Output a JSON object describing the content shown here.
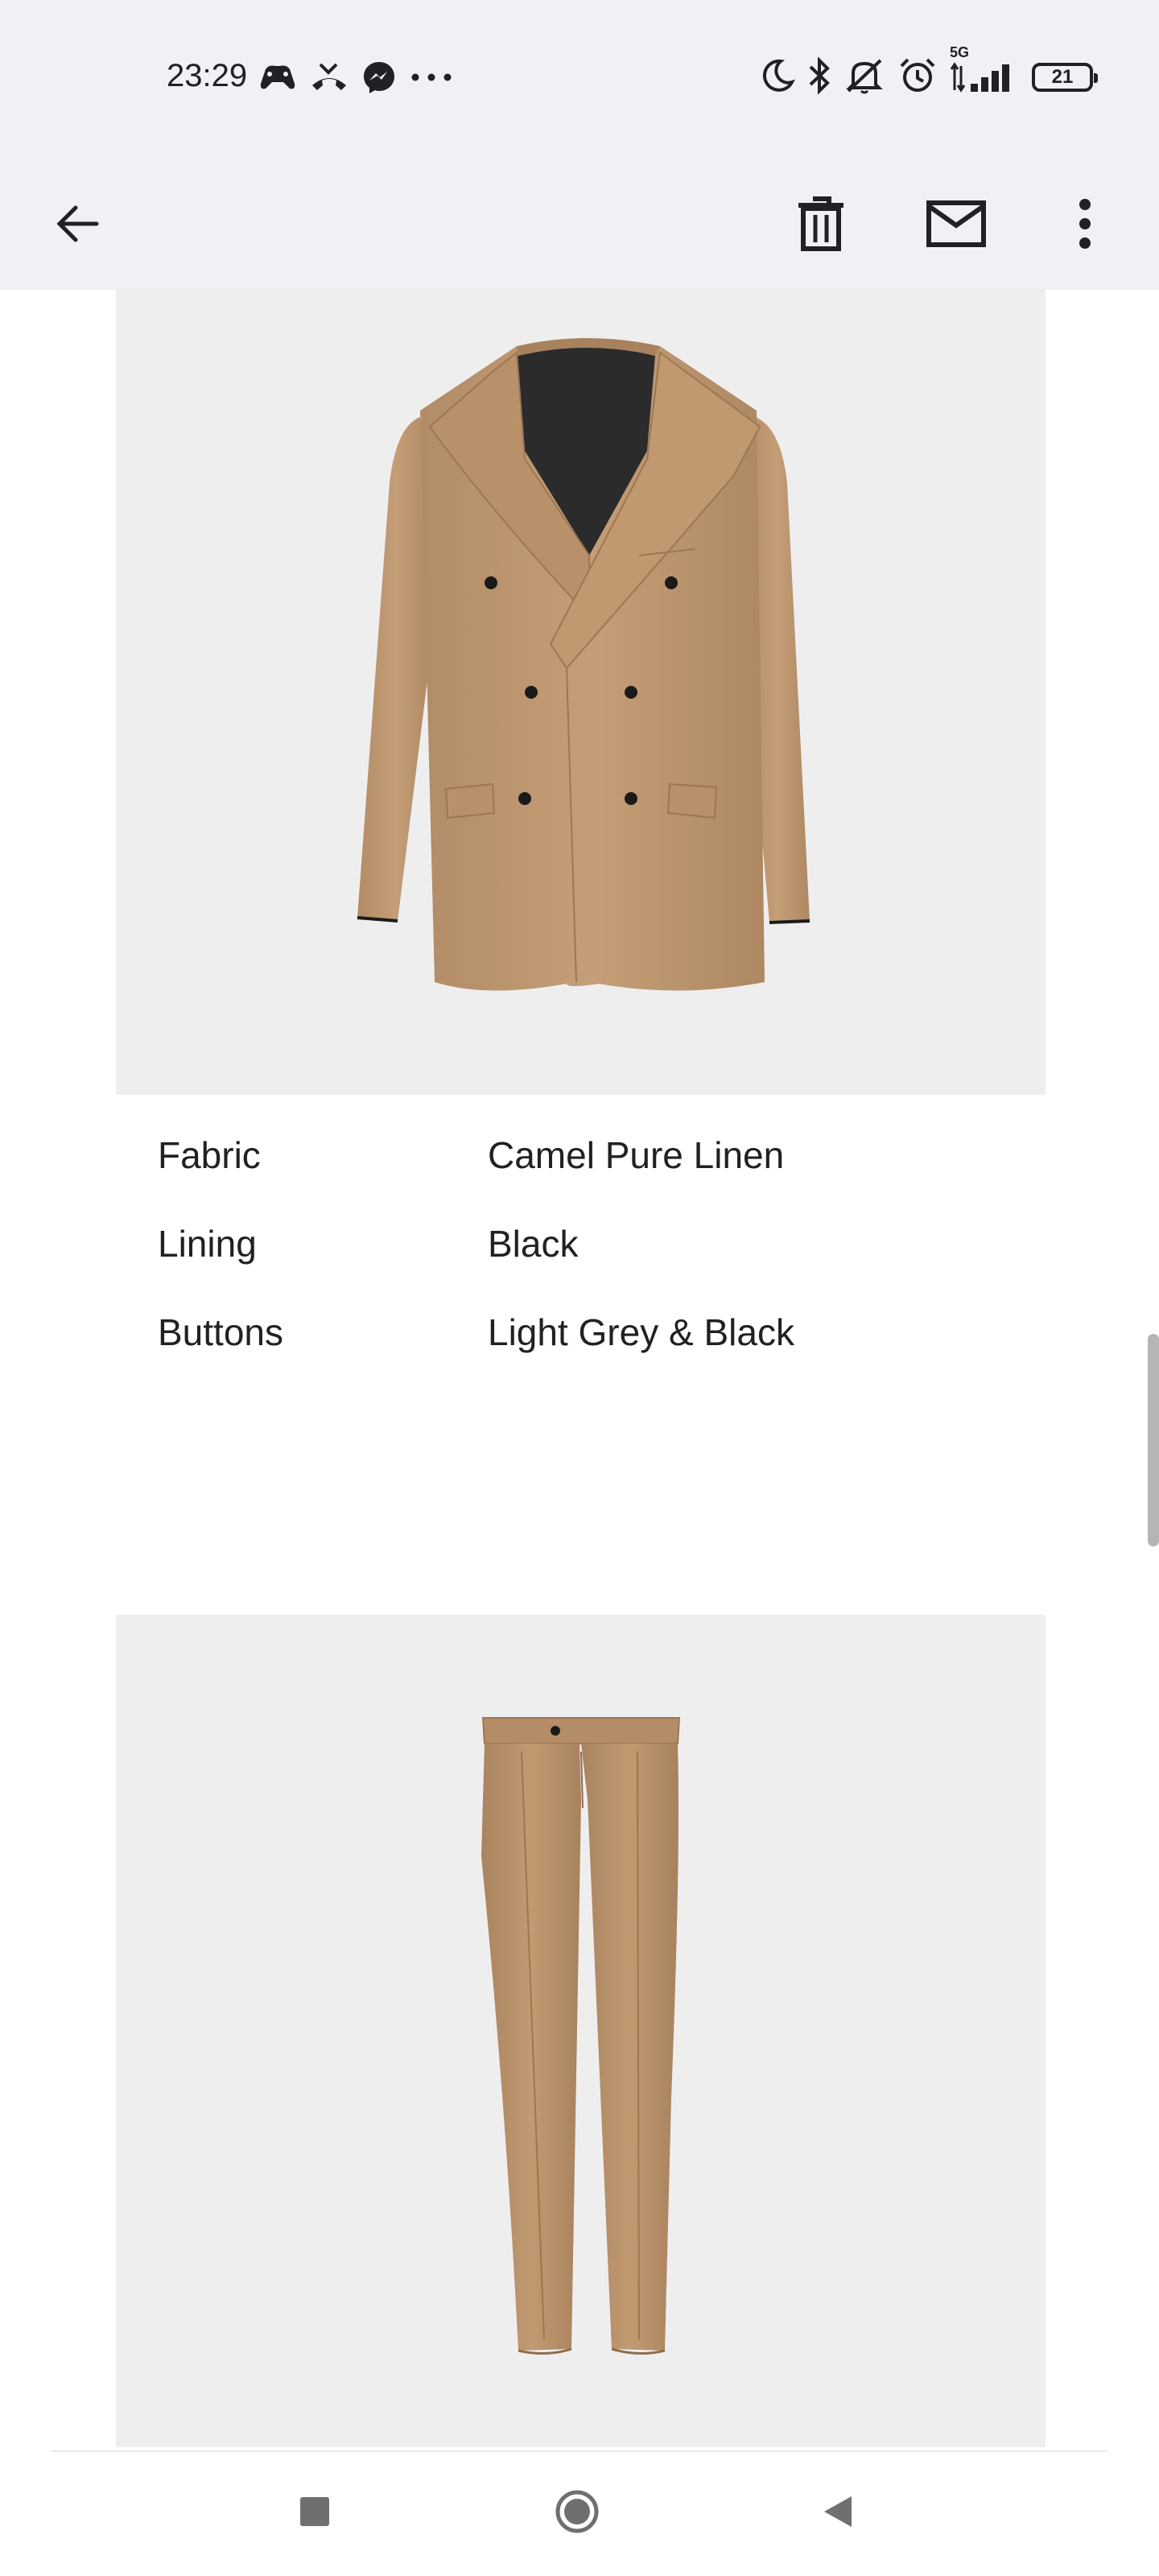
{
  "status_bar": {
    "time": "23:29",
    "network": "5G",
    "battery_level": "21",
    "left_icons": [
      "game-controller-icon",
      "missed-call-icon",
      "messenger-icon",
      "more-dots-icon"
    ],
    "right_icons": [
      "moon-icon",
      "bluetooth-icon",
      "mute-icon",
      "alarm-icon",
      "signal-icon",
      "battery-icon"
    ]
  },
  "app_bar": {
    "back": "arrow-left-icon",
    "actions": [
      "trash-icon",
      "mail-icon",
      "more-vert-icon"
    ]
  },
  "jacket": {
    "image": "jacket-image",
    "specs": [
      {
        "label": "Fabric",
        "value": "Camel Pure Linen"
      },
      {
        "label": "Lining",
        "value": "Black"
      },
      {
        "label": "Buttons",
        "value": "Light Grey & Black"
      }
    ]
  },
  "trousers": {
    "image": "trousers-image"
  },
  "colors": {
    "fabric": "#c29a72",
    "lining": "#2b2b2b",
    "panel_bg": "#efeeef",
    "bar_bg": "#eff1f5"
  },
  "nav_bar": {
    "buttons": [
      "recents-square-icon",
      "home-circle-icon",
      "back-triangle-icon"
    ]
  }
}
